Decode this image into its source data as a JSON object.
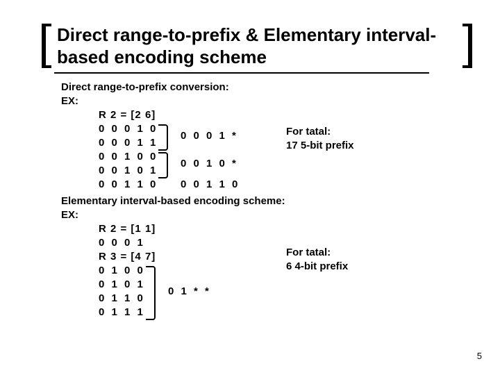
{
  "title": "Direct range-to-prefix & Elementary interval-based encoding scheme",
  "section1": {
    "heading": "Direct range-to-prefix conversion:",
    "ex": "EX:",
    "range": "R 2 = [2 6]",
    "rows": [
      "0 0 0 1 0",
      "0 0 0 1 1",
      "0 0 1 0 0",
      "0 0 1 0 1",
      "0 0 1 1 0"
    ],
    "res1": "0 0 0 1 *",
    "res2": "0 0 1 0 *",
    "res3": "0 0 1 1 0",
    "note1": "For tatal:",
    "note2": "17  5-bit  prefix"
  },
  "section2": {
    "heading": "Elementary interval-based encoding scheme:",
    "ex": "EX:",
    "rangeA": "R 2 = [1 1]",
    "rowA": "0 0 0 1",
    "rangeB": "R 3 = [4 7]",
    "rowsB": [
      "0 1 0 0",
      "0 1 0 1",
      "0 1 1 0",
      "0 1 1 1"
    ],
    "res": "0 1 * *",
    "note1": "For tatal:",
    "note2": "6   4-bit  prefix"
  },
  "page": "5"
}
